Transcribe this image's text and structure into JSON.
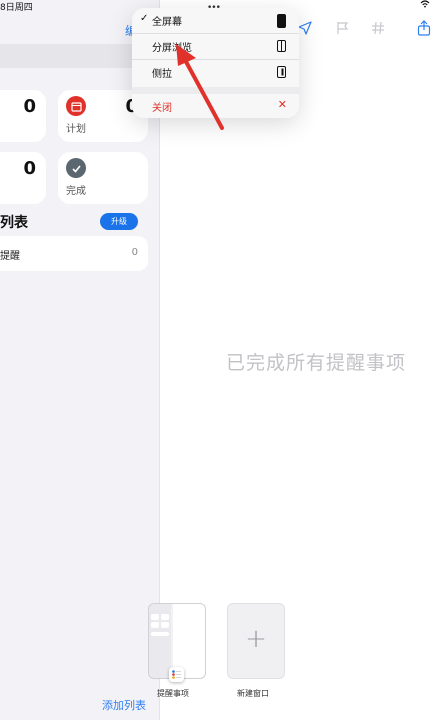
{
  "status": {
    "date": "8日周四"
  },
  "sidebar": {
    "edit_label": "编",
    "cards": [
      {
        "count": "0",
        "label": ""
      },
      {
        "count": "0",
        "label": "计划"
      },
      {
        "count": "0",
        "label": ""
      },
      {
        "count": "",
        "label": "完成"
      }
    ],
    "lists_heading": "列表",
    "upgrade_label": "升级",
    "list_item": {
      "name": "提醒",
      "count": "0"
    },
    "add_list_label": "添加列表"
  },
  "detail": {
    "empty_message": "已完成所有提醒事项",
    "toolbar_icons": [
      "location-arrow-icon",
      "flag-icon",
      "hashtag-icon",
      "share-icon"
    ]
  },
  "menu": {
    "items": [
      {
        "label": "全屏幕",
        "checked": true,
        "icon": "fullscreen-icon"
      },
      {
        "label": "分屏浏览",
        "checked": false,
        "icon": "split-view-icon"
      },
      {
        "label": "侧拉",
        "checked": false,
        "icon": "slide-over-icon"
      },
      {
        "label": "关闭",
        "checked": false,
        "icon": "close-icon"
      }
    ],
    "check_glyph": "✓",
    "close_glyph": "✕"
  },
  "shelf": {
    "window_caption": "提醒事项",
    "new_window_caption": "新建窗口"
  },
  "colors": {
    "accent": "#2f7ff2",
    "danger": "#e0312a",
    "planned": "#e0312a",
    "completed": "#5a6670",
    "upgrade": "#1a73e8",
    "arrow": "#e0312a"
  }
}
